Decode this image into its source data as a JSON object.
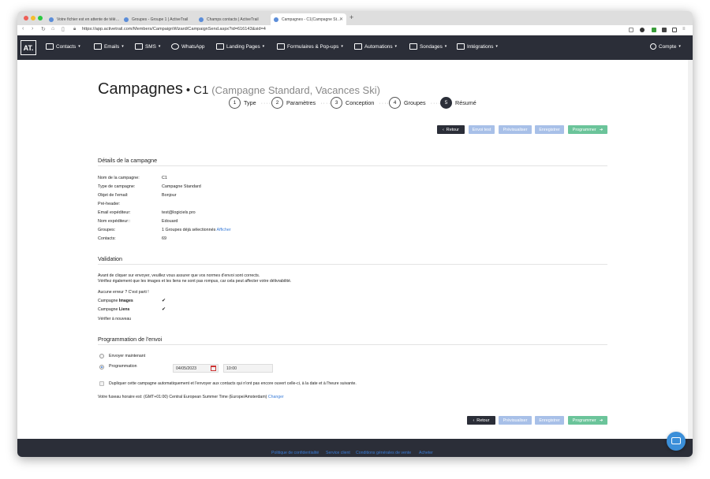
{
  "browser": {
    "tabs": [
      {
        "title": "Votre fichier est en attente de télé…"
      },
      {
        "title": "Groupes - Groupe 1 | ActiveTrail"
      },
      {
        "title": "Champs contacts | ActiveTrail"
      },
      {
        "title": "Campagnes - C1(Campagne St…"
      }
    ],
    "url": "https://app.activetrail.com/Members/CampaignWizard/CampaignSend.aspx?id=616143&sid=4"
  },
  "nav": {
    "logo": "AT.",
    "items": [
      "Contacts",
      "Emails",
      "SMS",
      "WhatsApp",
      "Landing Pages",
      "Formulaires & Pop-ups",
      "Automations",
      "Sondages",
      "Intégrations"
    ],
    "account": "Compte"
  },
  "page": {
    "title": "Campagnes",
    "bullet": "•",
    "campaign": "C1",
    "subtitle": "(Campagne Standard, Vacances Ski)"
  },
  "steps": [
    {
      "num": "1",
      "label": "Type"
    },
    {
      "num": "2",
      "label": "Paramètres"
    },
    {
      "num": "3",
      "label": "Conception"
    },
    {
      "num": "4",
      "label": "Groupes"
    },
    {
      "num": "5",
      "label": "Résumé"
    }
  ],
  "actions": {
    "back": "Retour",
    "test": "Envoi test",
    "preview": "Prévisualiser",
    "save": "Enregistrer",
    "schedule": "Programmer"
  },
  "details": {
    "title": "Détails de la campagne",
    "rows": [
      {
        "label": "Nom de la campagne:",
        "value": "C1"
      },
      {
        "label": "Type de campagne:",
        "value": "Campagne Standard"
      },
      {
        "label": "Objet de l'email:",
        "value": "Bonjour"
      },
      {
        "label": "Pré-header:",
        "value": ""
      },
      {
        "label": "Email expéditeur:",
        "value": "test@logiciels.pro"
      },
      {
        "label": "Nom expéditeur::",
        "value": "Edouard"
      },
      {
        "label": "Groupes:",
        "value": "1 Groupes déjà sélectionnés"
      },
      {
        "label": "Contacts:",
        "value": "69"
      }
    ],
    "groups_link": "Afficher"
  },
  "validation": {
    "title": "Validation",
    "line1": "Avant de cliquer sur envoyer, veuillez vous assurer que vos normes d'envoi sont corrects.",
    "line2": "Vérifiez également que les images et les liens ne sont pas rompus, car cela peut affecter votre délivrabilité.",
    "no_error": "Aucune erreur ? C'est parti !",
    "images_prefix": "Campagne",
    "images_bold": "Images",
    "links_prefix": "Campagne",
    "links_bold": "Liens",
    "check_glyph": "✔",
    "recheck": "Vérifier à nouveau"
  },
  "scheduling": {
    "title": "Programmation de l'envoi",
    "send_now": "Envoyer maintenant",
    "schedule": "Programmation",
    "date": "04/05/2023",
    "time": "10:00",
    "duplicate": "Dupliquer cette campagne automatiquement et l'envoyer aux contacts qui n'ont pas encore ouvert celle-ci, à la date et à l'heure suivante.",
    "timezone": "Votre fuseau horaire est: (GMT+01:00) Central European Summer Time (Europe/Amsterdam)",
    "timezone_link": "Changer"
  },
  "footer": {
    "links": [
      "Politique de confidentialité",
      "Service client",
      "Conditions générales de vente",
      "Acheter"
    ]
  }
}
